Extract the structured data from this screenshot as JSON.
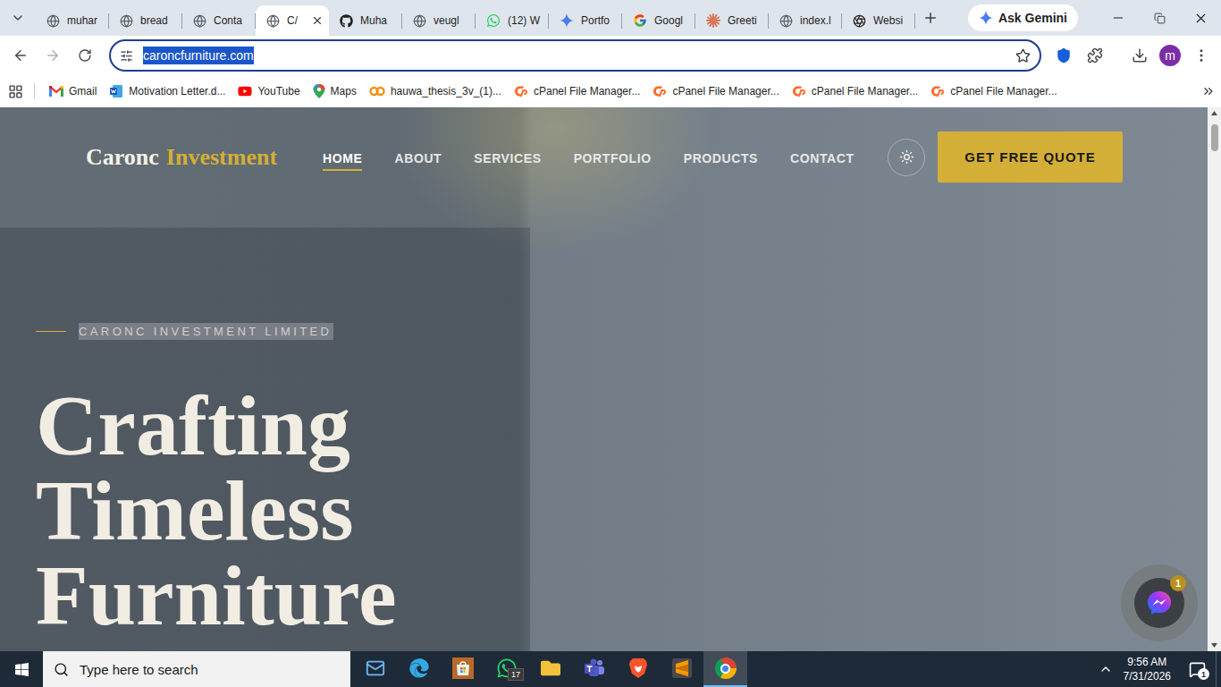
{
  "browser": {
    "tabs": [
      {
        "label": "muhar",
        "kind": "globe",
        "selected": false
      },
      {
        "label": "bread",
        "kind": "globe",
        "selected": false
      },
      {
        "label": "Conta",
        "kind": "globe",
        "selected": false
      },
      {
        "label": "C/",
        "kind": "globe",
        "selected": true
      },
      {
        "label": "Muha",
        "kind": "github",
        "selected": false
      },
      {
        "label": "veugl",
        "kind": "globe",
        "selected": false
      },
      {
        "label": "(12) W",
        "kind": "whatsapp",
        "selected": false
      },
      {
        "label": "Portfo",
        "kind": "gemini",
        "selected": false
      },
      {
        "label": "Googl",
        "kind": "google",
        "selected": false
      },
      {
        "label": "Greeti",
        "kind": "claude",
        "selected": false
      },
      {
        "label": "index.l",
        "kind": "globe",
        "selected": false
      },
      {
        "label": "Websi",
        "kind": "openai",
        "selected": false
      }
    ],
    "ask_gemini": "Ask Gemini",
    "address": "caroncfurniture.com",
    "address_selected": true,
    "profile": "m",
    "bookmarks": [
      {
        "label": "Gmail",
        "kind": "gmail"
      },
      {
        "label": "Motivation Letter.d...",
        "kind": "word"
      },
      {
        "label": "YouTube",
        "kind": "youtube"
      },
      {
        "label": "Maps",
        "kind": "maps"
      },
      {
        "label": "hauwa_thesis_3v_(1)...",
        "kind": "hauwa"
      },
      {
        "label": "cPanel File Manager...",
        "kind": "cpanel"
      },
      {
        "label": "cPanel File Manager...",
        "kind": "cpanel"
      },
      {
        "label": "cPanel File Manager...",
        "kind": "cpanel"
      },
      {
        "label": "cPanel File Manager...",
        "kind": "cpanel"
      }
    ]
  },
  "page": {
    "logo": {
      "name": "Caronc",
      "accent": "Investment"
    },
    "nav": [
      {
        "label": "HOME",
        "selected": true
      },
      {
        "label": "ABOUT",
        "selected": false
      },
      {
        "label": "SERVICES",
        "selected": false
      },
      {
        "label": "PORTFOLIO",
        "selected": false
      },
      {
        "label": "PRODUCTS",
        "selected": false
      },
      {
        "label": "CONTACT",
        "selected": false
      }
    ],
    "quote_button": "GET FREE QUOTE",
    "eyebrow": "CARONC INVESTMENT LIMITED",
    "eyebrow_selected": true,
    "heading": [
      "Crafting",
      "Timeless",
      "Furniture"
    ],
    "messenger_badge": "1"
  },
  "taskbar": {
    "search_placeholder": "Type here to search",
    "apps": [
      {
        "kind": "mail",
        "active": false
      },
      {
        "kind": "edge",
        "active": false
      },
      {
        "kind": "store",
        "active": false
      },
      {
        "kind": "whatsapp",
        "active": false,
        "badge": "17"
      },
      {
        "kind": "explorer",
        "active": false
      },
      {
        "kind": "teams",
        "active": false
      },
      {
        "kind": "brave",
        "active": false
      },
      {
        "kind": "sublime",
        "active": false
      },
      {
        "kind": "chrome",
        "active": true
      }
    ],
    "time": "9:56 AM",
    "date": "7/31/2026",
    "notifications": "1"
  }
}
